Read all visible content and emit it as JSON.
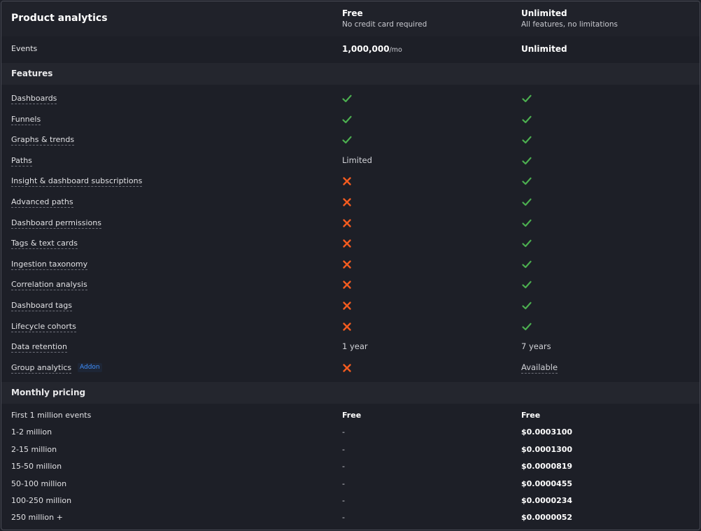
{
  "header": {
    "title": "Product analytics",
    "plans": [
      {
        "name": "Free",
        "subtitle": "No credit card required"
      },
      {
        "name": "Unlimited",
        "subtitle": "All features, no limitations"
      }
    ]
  },
  "events": {
    "label": "Events",
    "free_value": "1,000,000",
    "free_unit": "/mo",
    "unlimited_value": "Unlimited"
  },
  "features": {
    "title": "Features",
    "rows": [
      {
        "label": "Dashboards",
        "free": "check",
        "unlimited": "check"
      },
      {
        "label": "Funnels",
        "free": "check",
        "unlimited": "check"
      },
      {
        "label": "Graphs & trends",
        "free": "check",
        "unlimited": "check"
      },
      {
        "label": "Paths",
        "free": "Limited",
        "unlimited": "check"
      },
      {
        "label": "Insight & dashboard subscriptions",
        "free": "cross",
        "unlimited": "check"
      },
      {
        "label": "Advanced paths",
        "free": "cross",
        "unlimited": "check"
      },
      {
        "label": "Dashboard permissions",
        "free": "cross",
        "unlimited": "check"
      },
      {
        "label": "Tags & text cards",
        "free": "cross",
        "unlimited": "check"
      },
      {
        "label": "Ingestion taxonomy",
        "free": "cross",
        "unlimited": "check"
      },
      {
        "label": "Correlation analysis",
        "free": "cross",
        "unlimited": "check"
      },
      {
        "label": "Dashboard tags",
        "free": "cross",
        "unlimited": "check"
      },
      {
        "label": "Lifecycle cohorts",
        "free": "cross",
        "unlimited": "check"
      },
      {
        "label": "Data retention",
        "free": "1 year",
        "unlimited": "7 years"
      },
      {
        "label": "Group analytics",
        "badge": "Addon",
        "free": "cross",
        "unlimited": "Available"
      }
    ]
  },
  "pricing": {
    "title": "Monthly pricing",
    "rows": [
      {
        "label": "First 1 million events",
        "free": "Free",
        "unlimited": "Free"
      },
      {
        "label": "1-2 million",
        "free": "-",
        "unlimited": "$0.0003100"
      },
      {
        "label": "2-15 million",
        "free": "-",
        "unlimited": "$0.0001300"
      },
      {
        "label": "15-50 million",
        "free": "-",
        "unlimited": "$0.0000819"
      },
      {
        "label": "50-100 million",
        "free": "-",
        "unlimited": "$0.0000455"
      },
      {
        "label": "100-250 million",
        "free": "-",
        "unlimited": "$0.0000234"
      },
      {
        "label": "250 million +",
        "free": "-",
        "unlimited": "$0.0000052"
      }
    ]
  },
  "colors": {
    "check": "#4caf50",
    "cross": "#f35b1f",
    "addon": "#3f8efb"
  },
  "icons": {
    "check": "checkmark-icon",
    "cross": "x-mark-icon"
  }
}
